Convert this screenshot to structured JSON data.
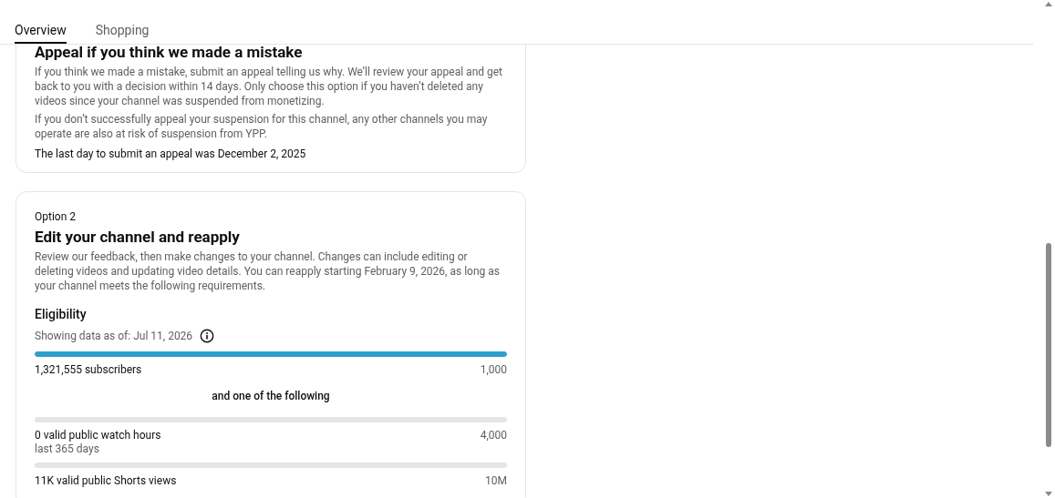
{
  "tabs": [
    {
      "label": "Overview",
      "selected": true
    },
    {
      "label": "Shopping",
      "selected": false
    }
  ],
  "option_1": {
    "title": "Appeal if you think we made a mistake",
    "paragraphs": [
      "If you think we made a mistake, submit an appeal telling us why. We’ll review your appeal and get back to you with a decision within 14 days. Only choose this option if you haven’t deleted any videos since your channel was suspended from monetizing.",
      "If you don’t successfully appeal your suspension for this channel, any other channels you may operate are also at risk of suspension from YPP."
    ],
    "deadline": "The last day to submit an appeal was December 2, 2025"
  },
  "option_2": {
    "label": "Option 2",
    "title": "Edit your channel and reapply",
    "description": "Review our feedback, then make changes to your channel. Changes can include editing or deleting videos and updating video details. You can reapply starting February 9, 2026, as long as your channel meets the following requirements.",
    "eligibility_title": "Eligibility",
    "data_as_of": "Showing data as of: Jul 11, 2026",
    "metrics": [
      {
        "kind": "metric",
        "label": "1,321,555 subscribers",
        "target": "1,000",
        "level": 1
      },
      {
        "kind": "separator",
        "label": "and one of the following"
      },
      {
        "kind": "metric",
        "label": "0 valid public watch hours",
        "sublabel": "last 365 days",
        "target": "4,000",
        "level": 0
      },
      {
        "kind": "metric",
        "label": "11K valid public Shorts views",
        "target": "10M",
        "level": 0
      }
    ]
  }
}
